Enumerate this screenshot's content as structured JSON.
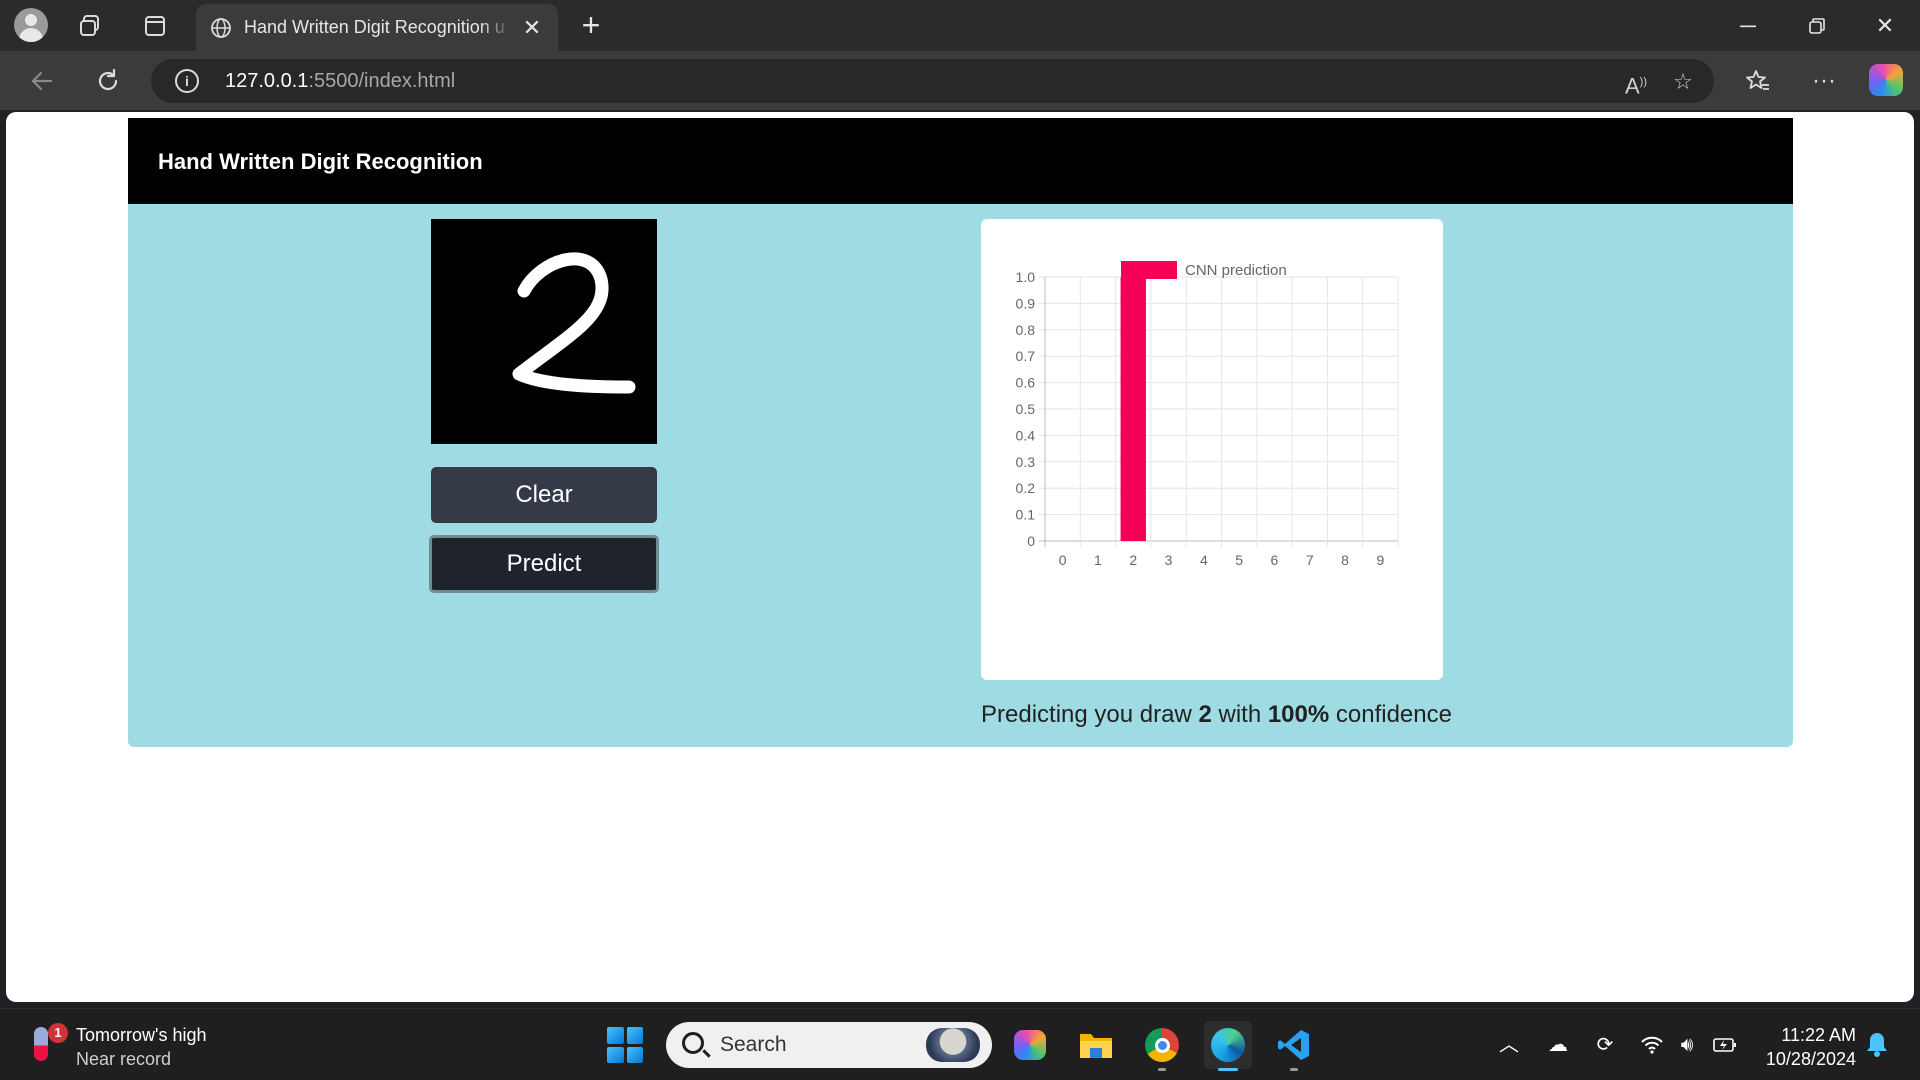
{
  "browser": {
    "tab_title": "Hand Written Digit Recognition u",
    "url_host": "127.0.0.1",
    "url_path": ":5500/index.html"
  },
  "page": {
    "header_title": "Hand Written Digit Recognition",
    "canvas_drawn_digit": "2",
    "clear_label": "Clear",
    "predict_label": "Predict",
    "result_prefix": "Predicting you draw ",
    "result_digit": "2",
    "result_middle": " with ",
    "result_confidence": "100%",
    "result_suffix": " confidence"
  },
  "chart_data": {
    "type": "bar",
    "categories": [
      "0",
      "1",
      "2",
      "3",
      "4",
      "5",
      "6",
      "7",
      "8",
      "9"
    ],
    "series": [
      {
        "name": "CNN prediction",
        "values": [
          0,
          0,
          1.0,
          0,
          0,
          0,
          0,
          0,
          0,
          0
        ],
        "color": "#f50057"
      }
    ],
    "y_ticks": [
      "0",
      "0.1",
      "0.2",
      "0.3",
      "0.4",
      "0.5",
      "0.6",
      "0.7",
      "0.8",
      "0.9",
      "1.0"
    ],
    "ylim": [
      0,
      1.0
    ],
    "grid": true,
    "legend": "top"
  },
  "taskbar": {
    "weather_title": "Tomorrow's high",
    "weather_sub": "Near record",
    "weather_badge": "1",
    "search_placeholder": "Search",
    "time": "11:22 AM",
    "date": "10/28/2024"
  },
  "colors": {
    "page_bg": "#9fdbe2",
    "header_bg": "#000000",
    "bar": "#f50057",
    "clear_btn": "#343a46",
    "predict_btn": "#1f232b"
  }
}
